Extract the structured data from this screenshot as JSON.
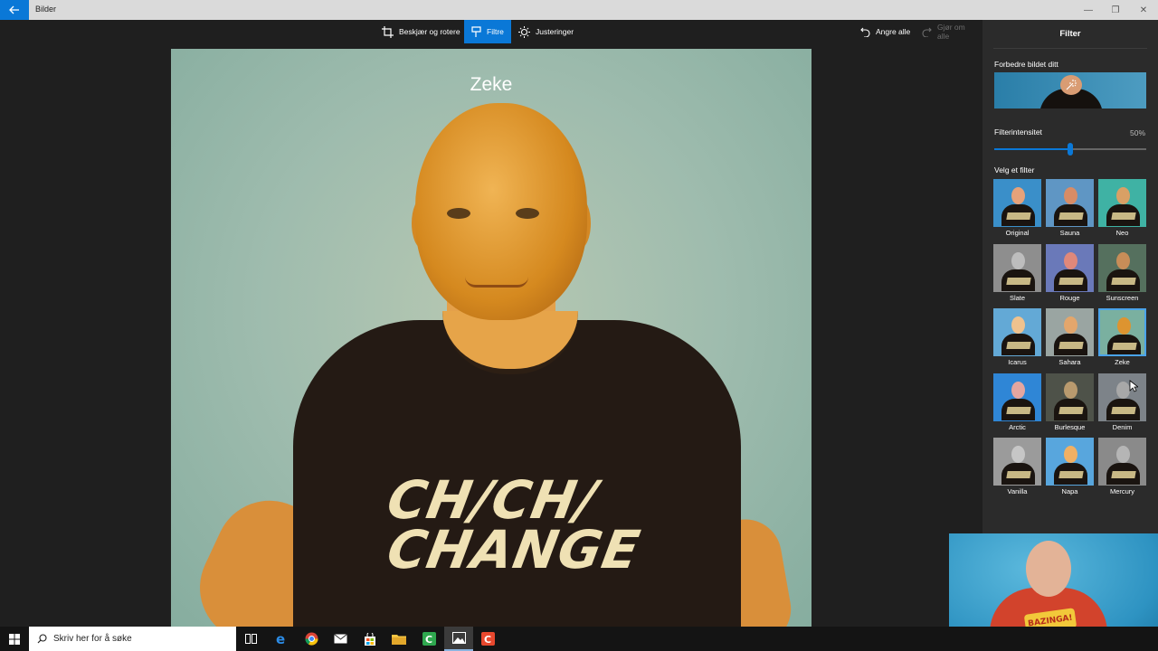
{
  "window": {
    "title": "Bilder"
  },
  "toolbar": {
    "crop_label": "Beskjær og rotere",
    "filters_label": "Filtre",
    "adjust_label": "Justeringer",
    "undo_all_label": "Angre alle",
    "redo_all_label": "Gjør om alle"
  },
  "photo": {
    "filter_overlay_label": "Zeke",
    "shirt_line1": "CH/CH/",
    "shirt_line2": "CHANGE"
  },
  "panel": {
    "title": "Filter",
    "enhance_label": "Forbedre bildet ditt",
    "intensity_label": "Filterintensitet",
    "intensity_value": "50%",
    "intensity_level": 0.5,
    "choose_label": "Velg et filter",
    "selected_filter": "Zeke",
    "filters": [
      {
        "name": "Original",
        "bg": "#3a8fc9",
        "skin": "#e6a27a"
      },
      {
        "name": "Sauna",
        "bg": "#5f96c4",
        "skin": "#d88c66"
      },
      {
        "name": "Neo",
        "bg": "#3fb2a4",
        "skin": "#d9a065"
      },
      {
        "name": "Slate",
        "bg": "#8e8e8e",
        "skin": "#bdbdbd"
      },
      {
        "name": "Rouge",
        "bg": "#6a79b9",
        "skin": "#e0887a"
      },
      {
        "name": "Sunscreen",
        "bg": "#55705e",
        "skin": "#c78d58"
      },
      {
        "name": "Icarus",
        "bg": "#63a9d6",
        "skin": "#efc28e"
      },
      {
        "name": "Sahara",
        "bg": "#9aa5a2",
        "skin": "#e3a66c"
      },
      {
        "name": "Zeke",
        "bg": "#7ab0a0",
        "skin": "#dd9430"
      },
      {
        "name": "Arctic",
        "bg": "#2f86d6",
        "skin": "#e4a6a0"
      },
      {
        "name": "Burlesque",
        "bg": "#4e5249",
        "skin": "#b99a6e"
      },
      {
        "name": "Denim",
        "bg": "#7d8389",
        "skin": "#a8a8a8"
      },
      {
        "name": "Vanilla",
        "bg": "#9b9b9b",
        "skin": "#c6c6c6"
      },
      {
        "name": "Napa",
        "bg": "#58a6dd",
        "skin": "#f0b064"
      },
      {
        "name": "Mercury",
        "bg": "#8a8a8a",
        "skin": "#b5b5b5"
      }
    ]
  },
  "webcam": {
    "shirt_text": "BAZINGA!"
  },
  "taskbar": {
    "search_placeholder": "Skriv her for å søke",
    "apps": [
      "task-view",
      "edge",
      "chrome",
      "mail",
      "store",
      "file-explorer",
      "camtasia",
      "photos",
      "camtasia-recorder"
    ]
  }
}
